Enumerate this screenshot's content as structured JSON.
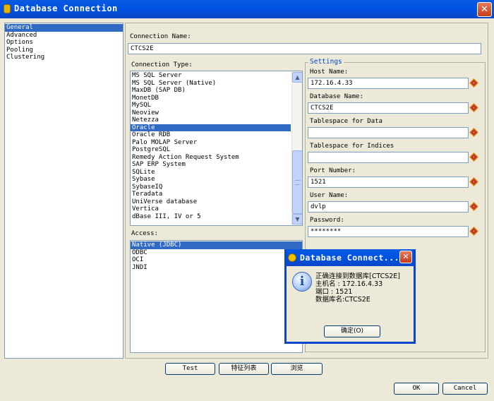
{
  "window": {
    "title": "Database Connection"
  },
  "nav": {
    "items": [
      "General",
      "Advanced",
      "Options",
      "Pooling",
      "Clustering"
    ],
    "selected": 0
  },
  "connection_name": {
    "label": "Connection Name:",
    "value": "CTCS2E"
  },
  "connection_type": {
    "label": "Connection Type:",
    "items": [
      "MS SQL Server",
      "MS SQL Server (Native)",
      "MaxDB (SAP DB)",
      "MonetDB",
      "MySQL",
      "Neoview",
      "Netezza",
      "Oracle",
      "Oracle RDB",
      "Palo MOLAP Server",
      "PostgreSQL",
      "Remedy Action Request System",
      "SAP ERP System",
      "SQLite",
      "Sybase",
      "SybaseIQ",
      "Teradata",
      "UniVerse database",
      "Vertica",
      "dBase III, IV or 5"
    ],
    "selected": 7
  },
  "access": {
    "label": "Access:",
    "items": [
      "Native (JDBC)",
      "ODBC",
      "OCI",
      "JNDI"
    ],
    "selected": 0
  },
  "settings": {
    "legend": "Settings",
    "host": {
      "label": "Host Name:",
      "value": "172.16.4.33"
    },
    "database": {
      "label": "Database Name:",
      "value": "CTCS2E"
    },
    "ts_data": {
      "label": "Tablespace for Data",
      "value": ""
    },
    "ts_index": {
      "label": "Tablespace for Indices",
      "value": ""
    },
    "port": {
      "label": "Port Number:",
      "value": "1521"
    },
    "user": {
      "label": "User Name:",
      "value": "dvlp"
    },
    "password": {
      "label": "Password:",
      "value": "********"
    }
  },
  "buttons": {
    "test": "Test",
    "features": "特征列表",
    "browse": "浏览",
    "ok": "OK",
    "cancel": "Cancel"
  },
  "dialog": {
    "title": "Database Connect...",
    "lines": [
      "正确连接到数据库[CTCS2E]",
      "主机名        :  172.16.4.33",
      "端口          :  1521",
      "数据库名:CTCS2E"
    ],
    "ok_label": "确定(O)"
  },
  "icons": {
    "window": "database-app-icon",
    "close": "close-icon",
    "info": "info-icon",
    "required": "required-diamond-icon"
  },
  "colors": {
    "titlebar": "#0054e3",
    "selection": "#316ac5",
    "close_button": "#c53b18",
    "surface": "#ece9d8"
  }
}
